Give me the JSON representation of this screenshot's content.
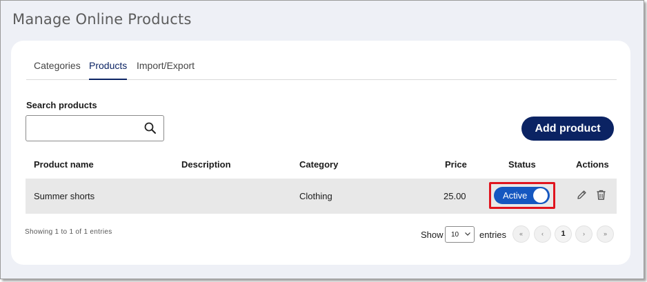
{
  "page": {
    "title": "Manage Online Products"
  },
  "tabs": [
    {
      "label": "Categories",
      "active": false
    },
    {
      "label": "Products",
      "active": true
    },
    {
      "label": "Import/Export",
      "active": false
    }
  ],
  "search": {
    "label": "Search products",
    "value": "",
    "icon": "search-icon"
  },
  "toolbar": {
    "add_label": "Add product"
  },
  "table": {
    "columns": [
      "Product name",
      "Description",
      "Category",
      "Price",
      "Status",
      "Actions"
    ],
    "rows": [
      {
        "name": "Summer shorts",
        "description": "",
        "category": "Clothing",
        "price": "25.00",
        "status": "Active",
        "status_on": true,
        "actions": [
          "edit-icon",
          "trash-icon"
        ]
      }
    ]
  },
  "footer": {
    "info": "Showing 1 to 1 of 1 entries",
    "show_label": "Show",
    "entries_value": "10",
    "entries_label": "entries",
    "pagination": [
      "«",
      "‹",
      "1",
      "›",
      "»"
    ],
    "current_page": "1"
  },
  "colors": {
    "primary": "#0b2363",
    "toggle": "#1557c0",
    "highlight": "#e0141e",
    "row_bg": "#e8e8e8",
    "page_bg": "#eef0f6"
  }
}
